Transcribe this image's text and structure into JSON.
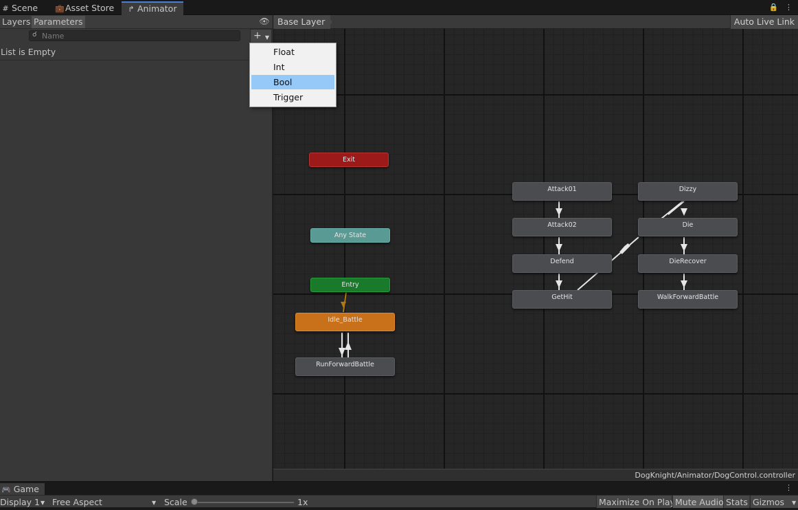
{
  "tabs": [
    {
      "label": "Scene",
      "icon": "grid-icon"
    },
    {
      "label": "Asset Store",
      "icon": "bag-icon"
    },
    {
      "label": "Animator",
      "icon": "animator-icon",
      "active": true
    }
  ],
  "left_panel": {
    "tabs": [
      {
        "label": "Layers"
      },
      {
        "label": "Parameters",
        "selected": true
      }
    ],
    "search_placeholder": "Name",
    "list_status": "List is Empty"
  },
  "add_parameter_menu": {
    "items": [
      {
        "label": "Float"
      },
      {
        "label": "Int"
      },
      {
        "label": "Bool",
        "highlighted": true
      },
      {
        "label": "Trigger"
      }
    ]
  },
  "graph": {
    "breadcrumb": "Base Layer",
    "live_link": "Auto Live Link",
    "controller_path": "DogKnight/Animator/DogControl.controller",
    "states": [
      {
        "name": "Exit",
        "kind": "exit"
      },
      {
        "name": "Any State",
        "kind": "any"
      },
      {
        "name": "Entry",
        "kind": "entry"
      },
      {
        "name": "Idle_Battle",
        "kind": "default"
      },
      {
        "name": "RunForwardBattle",
        "kind": "normal"
      },
      {
        "name": "Attack01",
        "kind": "normal"
      },
      {
        "name": "Attack02",
        "kind": "normal"
      },
      {
        "name": "Defend",
        "kind": "normal"
      },
      {
        "name": "GetHit",
        "kind": "normal"
      },
      {
        "name": "Dizzy",
        "kind": "normal"
      },
      {
        "name": "Die",
        "kind": "normal"
      },
      {
        "name": "DieRecover",
        "kind": "normal"
      },
      {
        "name": "WalkForwardBattle",
        "kind": "normal"
      }
    ],
    "colors": {
      "exit": "#9c1a1a",
      "any": "#5a9a95",
      "entry": "#1a7a2c",
      "default": "#c8701a",
      "transition": "#e6e6e6",
      "entry_transition": "#b07a10"
    }
  },
  "game_panel": {
    "tab": "Game",
    "display": "Display 1",
    "aspect": "Free Aspect",
    "scale_label": "Scale",
    "scale_value": "1x",
    "buttons": [
      {
        "label": "Maximize On Play"
      },
      {
        "label": "Mute Audio",
        "on": true
      },
      {
        "label": "Stats"
      },
      {
        "label": "Gizmos"
      }
    ]
  }
}
